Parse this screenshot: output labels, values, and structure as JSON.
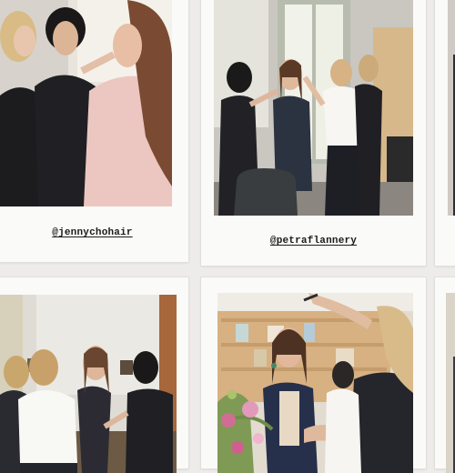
{
  "collage": {
    "background": "#eeecea",
    "card_color": "#fafaf8",
    "photos": [
      {
        "caption": "@jennychohair",
        "scene": "stylist-with-client-in-pink-robe"
      },
      {
        "caption": "@petraflannery",
        "scene": "styling-team-in-sunlit-room"
      },
      {
        "caption": "",
        "scene": "cropped-photo-edge"
      },
      {
        "caption": "",
        "scene": "glam-team-around-client"
      },
      {
        "caption": "",
        "scene": "makeup-with-bookshelf-and-flowers"
      },
      {
        "caption": "",
        "scene": "cropped-photo-edge"
      }
    ]
  }
}
